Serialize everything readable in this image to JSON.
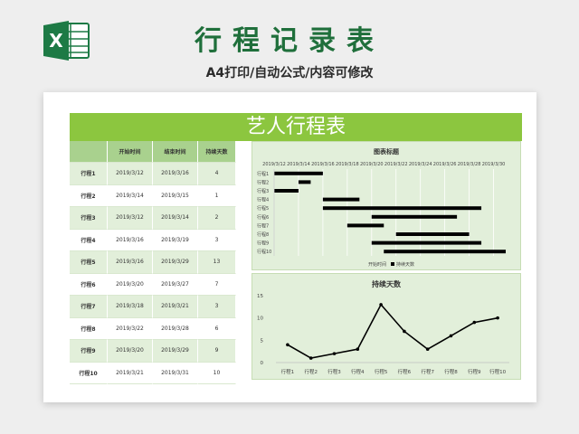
{
  "banner": {
    "title": "行程记录表",
    "subtitle": "A4打印/自动公式/内容可修改",
    "logo_icon": "excel-icon",
    "title_color": "#1f6f3b"
  },
  "sheet": {
    "title": "艺人行程表",
    "accent": "#8cc63f"
  },
  "table": {
    "headers": [
      "",
      "开始时间",
      "结束时间",
      "持续天数"
    ],
    "rows": [
      [
        "行程1",
        "2019/3/12",
        "2019/3/16",
        "4"
      ],
      [
        "行程2",
        "2019/3/14",
        "2019/3/15",
        "1"
      ],
      [
        "行程3",
        "2019/3/12",
        "2019/3/14",
        "2"
      ],
      [
        "行程4",
        "2019/3/16",
        "2019/3/19",
        "3"
      ],
      [
        "行程5",
        "2019/3/16",
        "2019/3/29",
        "13"
      ],
      [
        "行程6",
        "2019/3/20",
        "2019/3/27",
        "7"
      ],
      [
        "行程7",
        "2019/3/18",
        "2019/3/21",
        "3"
      ],
      [
        "行程8",
        "2019/3/22",
        "2019/3/28",
        "6"
      ],
      [
        "行程9",
        "2019/3/20",
        "2019/3/29",
        "9"
      ],
      [
        "行程10",
        "2019/3/21",
        "2019/3/31",
        "10"
      ]
    ]
  },
  "chart_data": [
    {
      "type": "bar",
      "orientation": "horizontal-stacked-gantt",
      "title": "图表标题",
      "categories": [
        "行程1",
        "行程2",
        "行程3",
        "行程4",
        "行程5",
        "行程6",
        "行程7",
        "行程8",
        "行程9",
        "行程10"
      ],
      "x_ticks": [
        "2019/3/12",
        "2019/3/14",
        "2019/3/16",
        "2019/3/18",
        "2019/3/20",
        "2019/3/22",
        "2019/3/24",
        "2019/3/26",
        "2019/3/28",
        "2019/3/30"
      ],
      "xlim": [
        "2019/3/12",
        "2019/3/31"
      ],
      "series": [
        {
          "name": "开始时间",
          "values": [
            "2019/3/12",
            "2019/3/14",
            "2019/3/12",
            "2019/3/16",
            "2019/3/16",
            "2019/3/20",
            "2019/3/18",
            "2019/3/22",
            "2019/3/20",
            "2019/3/21"
          ],
          "color": "none"
        },
        {
          "name": "持续天数",
          "values": [
            4,
            1,
            2,
            3,
            13,
            7,
            3,
            6,
            9,
            10
          ],
          "color": "#000000"
        }
      ],
      "legend": "bottom",
      "grid": true
    },
    {
      "type": "line",
      "title": "持续天数",
      "categories": [
        "行程1",
        "行程2",
        "行程3",
        "行程4",
        "行程5",
        "行程6",
        "行程7",
        "行程8",
        "行程9",
        "行程10"
      ],
      "values": [
        4,
        1,
        2,
        3,
        13,
        7,
        3,
        6,
        9,
        10
      ],
      "y_ticks": [
        0,
        5,
        10,
        15
      ],
      "ylim": [
        0,
        15
      ],
      "grid": false,
      "color": "#000000"
    }
  ]
}
